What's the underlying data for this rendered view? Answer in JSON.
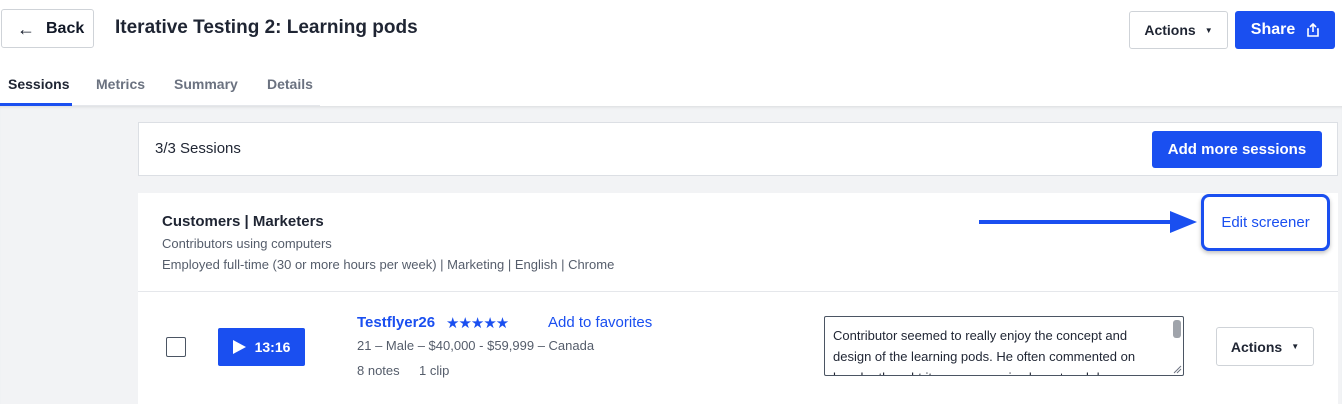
{
  "header": {
    "back_label": "Back",
    "title": "Iterative Testing 2: Learning pods",
    "actions_label": "Actions",
    "share_label": "Share"
  },
  "tabs": [
    {
      "label": "Sessions",
      "active": true
    },
    {
      "label": "Metrics",
      "active": false
    },
    {
      "label": "Summary",
      "active": false
    },
    {
      "label": "Details",
      "active": false
    }
  ],
  "sessions_bar": {
    "count_text": "3/3 Sessions",
    "add_button_label": "Add more sessions"
  },
  "group": {
    "title": "Customers | Marketers",
    "subtitle": "Contributors using computers",
    "criteria": "Employed full-time (30 or more hours per week) | Marketing | English | Chrome",
    "edit_screener_label": "Edit screener"
  },
  "session": {
    "duration": "13:16",
    "name": "Testflyer26",
    "stars": "★★★★★",
    "rating": 5,
    "favorite_label": "Add to favorites",
    "demographics": "21 – Male – $40,000 - $59,999 – Canada",
    "notes_count": "8 notes",
    "clips_count": "1 clip",
    "note_text": "Contributor seemed to really enjoy the concept and design of the learning pods. He often commented on how he thought it was a very nice layout and d…",
    "actions_label": "Actions"
  },
  "colors": {
    "accent": "#1a4ff0",
    "background_gray": "#f2f3f5",
    "text_dark": "#1f2533",
    "text_muted": "#555d6b"
  },
  "icons": {
    "back": "arrow-left-icon",
    "share": "share-icon",
    "caret": "caret-down-icon",
    "play": "play-icon",
    "star": "star-icon",
    "callout": "arrow-right-icon"
  }
}
